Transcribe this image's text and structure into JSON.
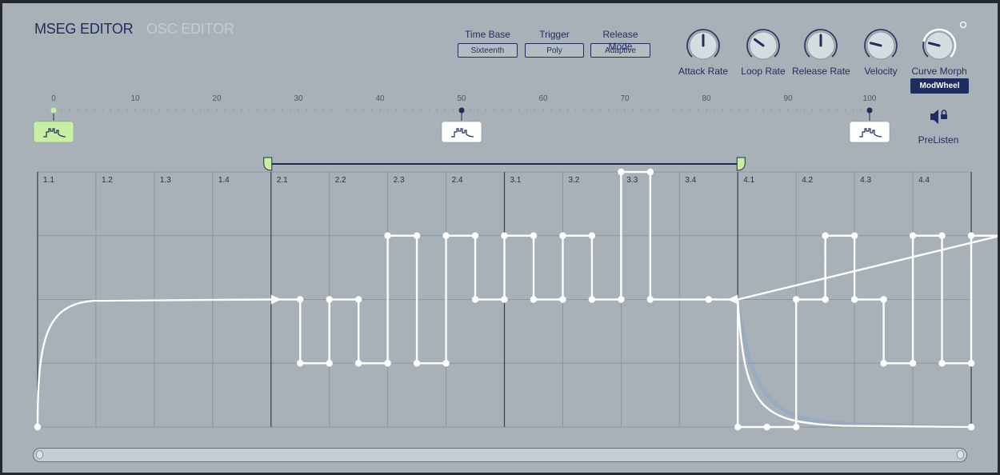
{
  "tabs": {
    "mseg": "MSEG EDITOR",
    "osc": "OSC EDITOR"
  },
  "controls": {
    "time_base": {
      "label": "Time Base",
      "value": "Sixteenth"
    },
    "trigger": {
      "label": "Trigger",
      "value": "Poly"
    },
    "release_mode": {
      "label": "Release Mode",
      "value": "Adaptive"
    }
  },
  "knobs": [
    {
      "label": "Attack Rate",
      "value": 0.5
    },
    {
      "label": "Loop Rate",
      "value": 0.3
    },
    {
      "label": "Release Rate",
      "value": 0.5
    },
    {
      "label": "Velocity",
      "value": 0.22
    },
    {
      "label": "Curve Morph",
      "value": 0.22
    }
  ],
  "modulation_source": "ModWheel",
  "prelisten_label": "PreListen",
  "ruler": {
    "ticks": [
      "0",
      "10",
      "20",
      "30",
      "40",
      "50",
      "60",
      "70",
      "80",
      "90",
      "100"
    ],
    "markers": [
      0,
      50,
      100
    ]
  },
  "beats": [
    "1.1",
    "1.2",
    "1.3",
    "1.4",
    "2.1",
    "2.2",
    "2.3",
    "2.4",
    "3.1",
    "3.2",
    "3.3",
    "3.4",
    "4.1",
    "4.2",
    "4.3",
    "4.4"
  ],
  "envelope": {
    "loop_start": "2.1",
    "loop_end": "4.1",
    "level_grid": [
      0,
      0.25,
      0.5,
      0.75,
      1
    ],
    "step_points": [
      [
        0.5,
        0.5
      ],
      [
        0.5,
        0.25
      ],
      [
        0.5,
        0.5
      ],
      [
        0.5,
        0.25
      ],
      [
        0.5,
        0.75
      ],
      [
        0.5,
        0.25
      ],
      [
        0.5,
        0.75
      ],
      [
        0.5,
        0.5
      ],
      [
        0.5,
        0.75
      ],
      [
        0.5,
        0.5
      ],
      [
        0.5,
        0.75
      ],
      [
        0.5,
        0.5
      ],
      [
        0.5,
        1
      ],
      [
        1,
        0.5
      ],
      [
        0.5,
        0.5
      ],
      [
        0.5,
        0
      ],
      [
        0.5,
        0
      ],
      [
        0.5,
        0.5
      ],
      [
        0.5,
        0.75
      ],
      [
        0.5,
        0.5
      ],
      [
        0.5,
        0.25
      ],
      [
        0.5,
        0.75
      ],
      [
        0.5,
        0.25
      ],
      [
        0.5,
        0.75
      ]
    ]
  },
  "colors": {
    "accent": "#1f2d5e",
    "active_marker": "#c7f0a3",
    "curve": "#ffffff",
    "background": "#a8b1b7"
  }
}
